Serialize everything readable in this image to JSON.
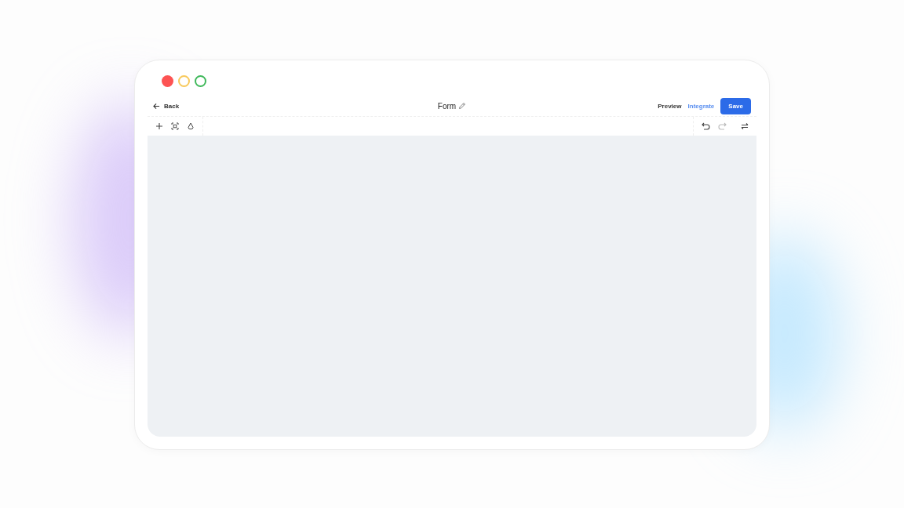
{
  "window": {
    "controls": [
      {
        "kind": "close"
      },
      {
        "kind": "minimize"
      },
      {
        "kind": "maximize"
      }
    ]
  },
  "header": {
    "back": "Back",
    "title": "Form",
    "preview": "Preview",
    "integrate": "Integrate",
    "save": "Save"
  },
  "toolbar": {
    "left_tools": [
      {
        "kind": "add",
        "disabled": false
      },
      {
        "kind": "select",
        "disabled": false
      },
      {
        "kind": "theme",
        "disabled": false
      }
    ],
    "right_tools": [
      {
        "kind": "undo",
        "disabled": false
      },
      {
        "kind": "redo",
        "disabled": true
      },
      {
        "kind": "swap",
        "disabled": false
      }
    ]
  }
}
